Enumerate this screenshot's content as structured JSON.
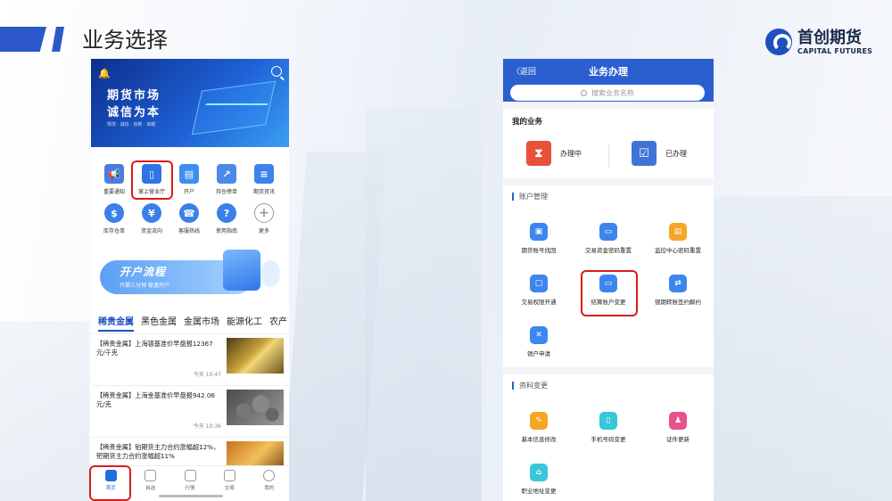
{
  "slide": {
    "title": "业务选择"
  },
  "logo": {
    "cn": "首创期货",
    "en": "CAPITAL FUTURES"
  },
  "phone1": {
    "banner": {
      "line1": "期货市场",
      "line2": "诚信为本",
      "line3": "规范 · 诚信 · 创新 · 卓越"
    },
    "icons": [
      {
        "label": "重要通知",
        "glyph": "📢",
        "color": "#4a7de0"
      },
      {
        "label": "掌上营业厅",
        "glyph": "▯",
        "color": "#2f74e6"
      },
      {
        "label": "开户",
        "glyph": "▤",
        "color": "#3d8ef0"
      },
      {
        "label": "持仓榜单",
        "glyph": "↗",
        "color": "#4a8ae8"
      },
      {
        "label": "期货资讯",
        "glyph": "≡",
        "color": "#3d82ee"
      },
      {
        "label": "库存仓单",
        "glyph": "$",
        "color": "#3b7fe8"
      },
      {
        "label": "资金流向",
        "glyph": "¥",
        "color": "#3b7fe8"
      },
      {
        "label": "客服热线",
        "glyph": "☎",
        "color": "#3b7fe8"
      },
      {
        "label": "使用指南",
        "glyph": "?",
        "color": "#3b7fe8"
      },
      {
        "label": "更多",
        "glyph": "+",
        "color": "#ffffff"
      }
    ],
    "promo": {
      "title": "开户流程",
      "subtitle": "只需三分钟  极速开户"
    },
    "tabs": [
      "稀贵金属",
      "黑色金属",
      "金属市场",
      "能源化工",
      "农产"
    ],
    "news": [
      {
        "title": "【稀贵金属】上海银基准价早盘报12367元/千克",
        "time": "今天 10:47"
      },
      {
        "title": "【稀贵金属】上海金基准价早盘报942.06元/克",
        "time": "今天 10:36"
      },
      {
        "title": "【稀贵金属】铂期货主力合约涨幅超12%，钯期货主力合约涨幅超11%",
        "time": ""
      }
    ],
    "nav": [
      "首页",
      "自选",
      "行情",
      "交易",
      "我的"
    ]
  },
  "phone2": {
    "back": "〈返回",
    "title": "业务办理",
    "search_placeholder": "搜索业务名称",
    "my_business": {
      "heading": "我的业务",
      "in_progress": "办理中",
      "done": "已办理"
    },
    "account_mgmt": {
      "heading": "账户管理",
      "items": [
        "期货账号找回",
        "交易资金密码重置",
        "监控中心密码重置",
        "交易权限开通",
        "结算账户变更",
        "银期转账签约解约",
        "销户申请"
      ]
    },
    "info_change": {
      "heading": "资料变更",
      "items": [
        "基本信息修改",
        "手机号码变更",
        "证件更新",
        "职业地址变更"
      ]
    }
  },
  "colors": {
    "accent": "#2b5fd0",
    "highlight": "#d91c1c"
  }
}
